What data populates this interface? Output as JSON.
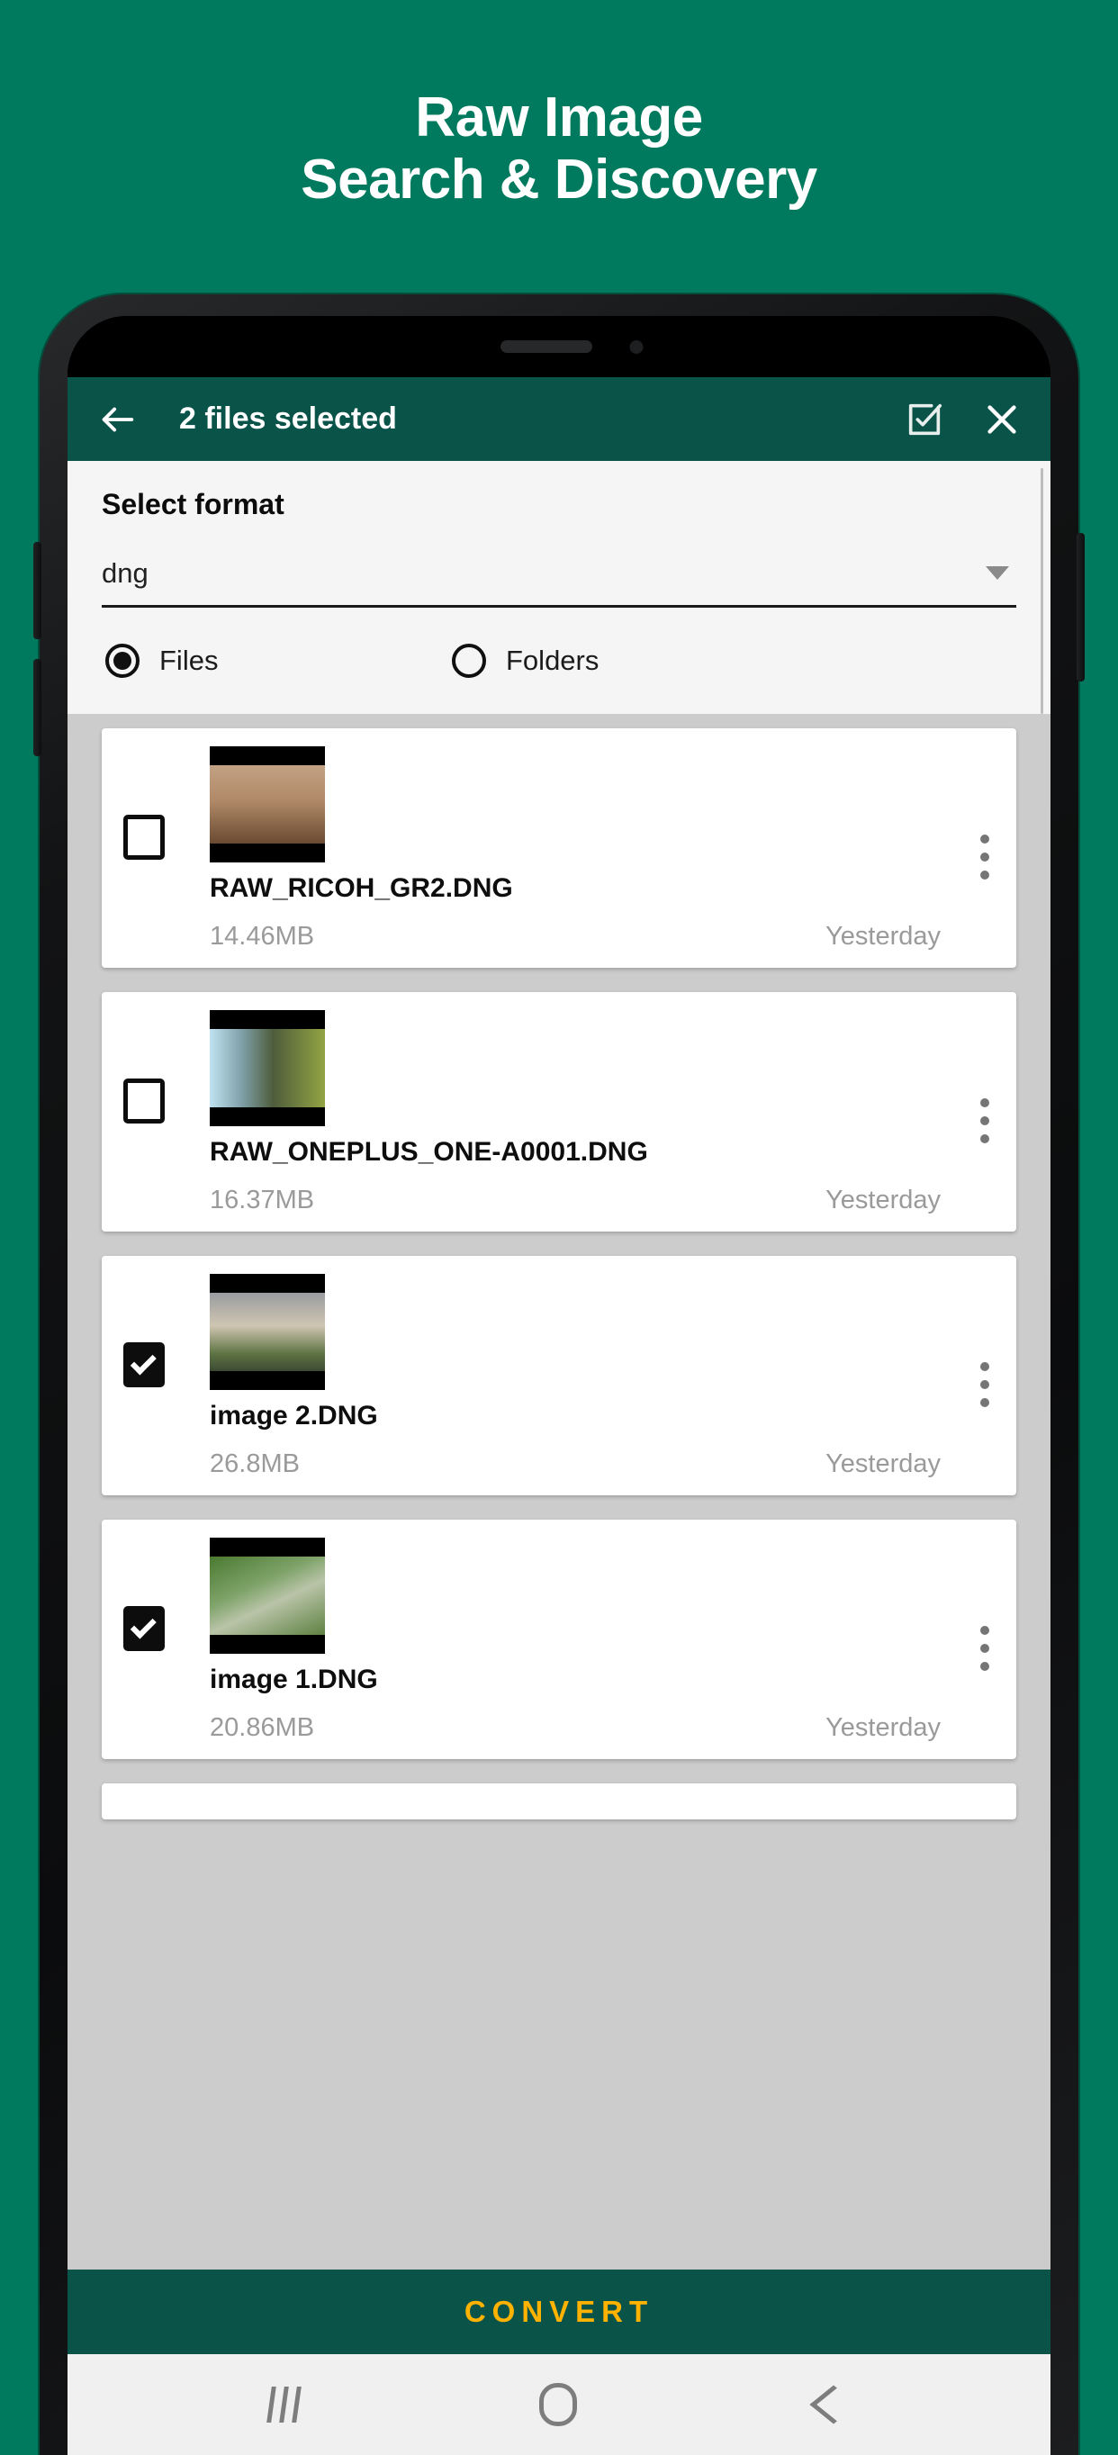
{
  "promo": {
    "line1": "Raw Image",
    "line2": "Search & Discovery",
    "background_color": "#007a5e",
    "text_color": "#ffffff"
  },
  "toolbar": {
    "back_icon": "arrow-left-icon",
    "title": "2 files selected",
    "select_all_icon": "checkbox-checked-outline-icon",
    "close_icon": "close-x-icon",
    "background_color": "#0a5349"
  },
  "format_panel": {
    "label": "Select format",
    "selected_value": "dng",
    "dropdown_icon": "chevron-down-icon",
    "radio_options": [
      {
        "label": "Files",
        "selected": true
      },
      {
        "label": "Folders",
        "selected": false
      }
    ]
  },
  "file_list": [
    {
      "name": "RAW_RICOH_GR2.DNG",
      "size": "14.46MB",
      "date": "Yesterday",
      "checked": false,
      "thumb_colors": [
        "#6b4f3c",
        "#c9a68a",
        "#8a5f3a"
      ]
    },
    {
      "name": "RAW_ONEPLUS_ONE-A0001.DNG",
      "size": "16.37MB",
      "date": "Yesterday",
      "checked": false,
      "thumb_colors": [
        "#9fd3e8",
        "#4a5a3a",
        "#9aa84a"
      ]
    },
    {
      "name": "image 2.DNG",
      "size": "26.8MB",
      "date": "Yesterday",
      "checked": true,
      "thumb_colors": [
        "#8d8f93",
        "#cfc3b0",
        "#4a6038"
      ]
    },
    {
      "name": "image 1.DNG",
      "size": "20.86MB",
      "date": "Yesterday",
      "checked": true,
      "thumb_colors": [
        "#3f6b2a",
        "#8fa87c",
        "#6f8c55"
      ]
    }
  ],
  "convert_button": {
    "label": "CONVERT",
    "text_color": "#ffb300",
    "background_color": "#0a5349"
  },
  "navbar": {
    "recents_icon": "recents-icon",
    "home_icon": "home-icon",
    "back_icon": "back-chevron-icon"
  }
}
